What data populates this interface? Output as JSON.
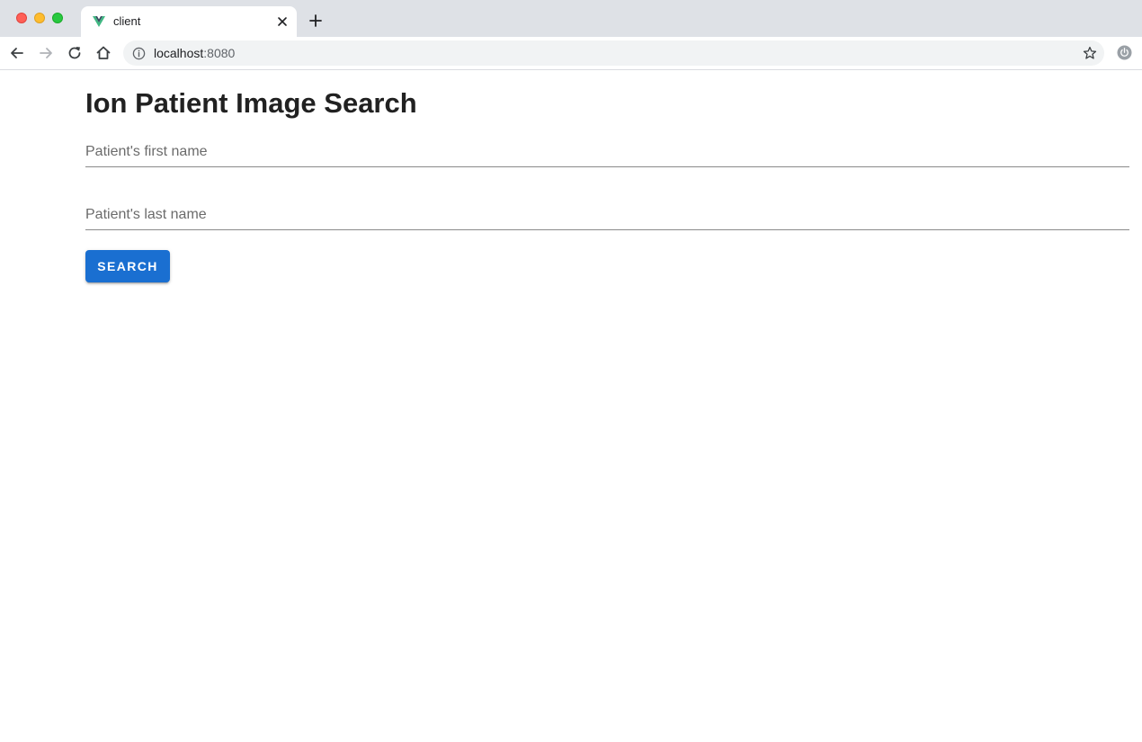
{
  "browser": {
    "tab": {
      "title": "client",
      "favicon": "vue-logo-icon"
    },
    "address_bar": {
      "host": "localhost",
      "port": ":8080"
    },
    "colors": {
      "tabstrip": "#dee1e6",
      "omnibox": "#f1f3f4"
    }
  },
  "page": {
    "title": "Ion Patient Image Search",
    "first_name_placeholder": "Patient's first name",
    "last_name_placeholder": "Patient's last name",
    "search_label": "SEARCH",
    "colors": {
      "accent": "#1a6fd1",
      "text": "#212121"
    }
  }
}
